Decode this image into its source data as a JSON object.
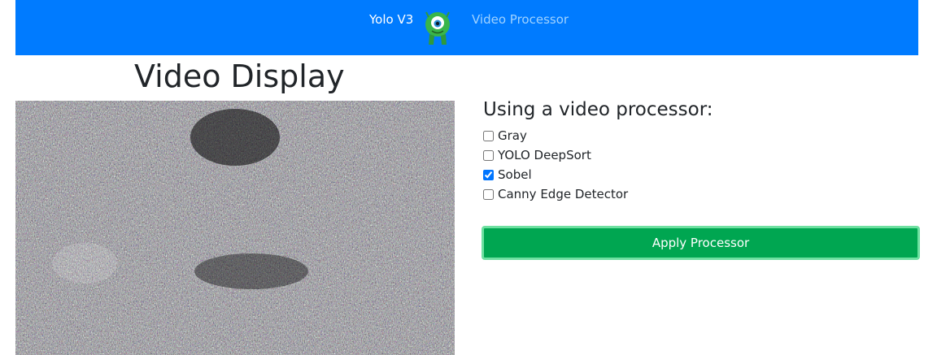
{
  "nav": {
    "brand": "Yolo V3",
    "link": "Video Processor",
    "colors": {
      "bar": "#007bff",
      "link": "#9fd2ff"
    }
  },
  "page": {
    "title": "Video Display"
  },
  "processor": {
    "heading": "Using a video processor:",
    "options": [
      {
        "label": "Gray",
        "checked": false
      },
      {
        "label": "YOLO DeepSort",
        "checked": false
      },
      {
        "label": "Sobel",
        "checked": true
      },
      {
        "label": "Canny Edge Detector",
        "checked": false
      }
    ],
    "apply_label": "Apply Processor",
    "button_color": "#00a651"
  },
  "video": {
    "content": "sobel-edge-filtered-frame"
  }
}
